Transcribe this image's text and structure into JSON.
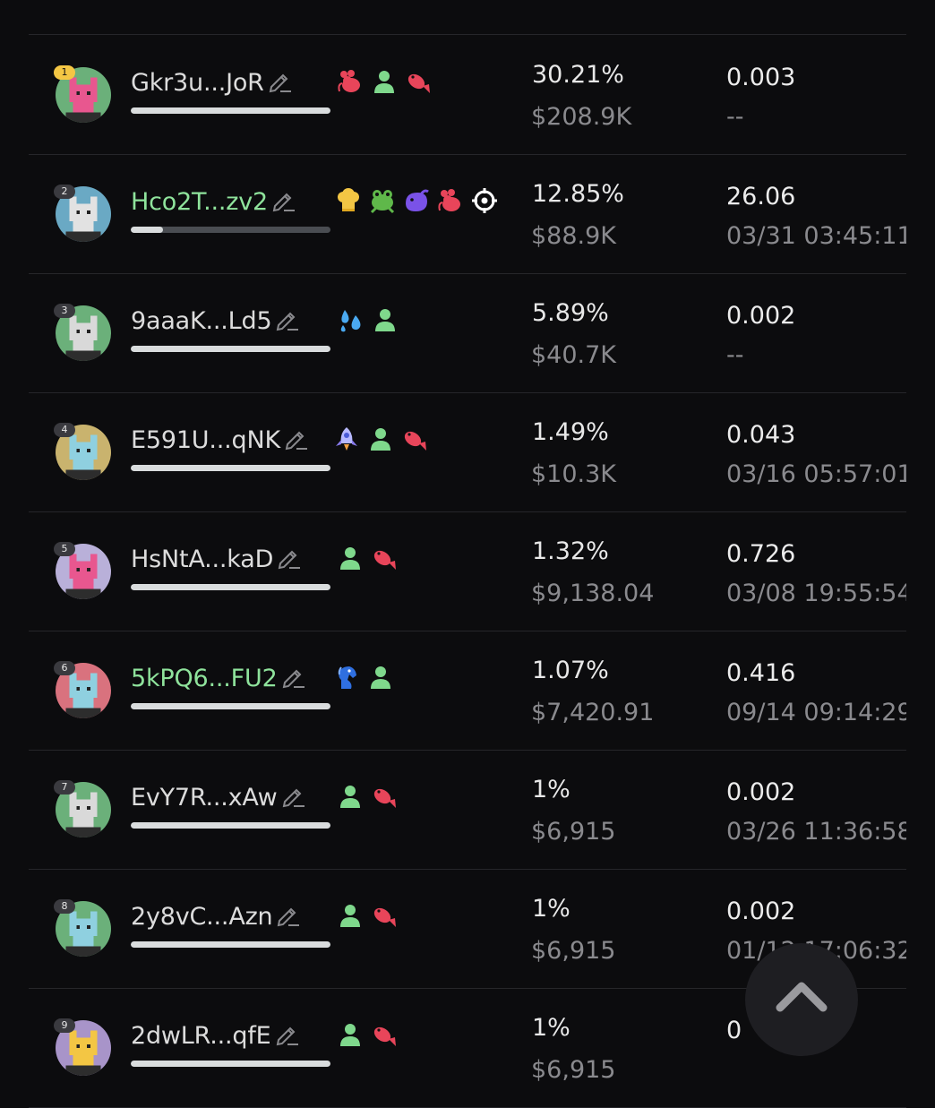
{
  "rows": [
    {
      "rank": "1",
      "name": "Gkr3u...JoR",
      "highlight": false,
      "pct": "30.21%",
      "usd": "$208.9K",
      "amount": "0.003",
      "time": "--",
      "bar": 1.0,
      "avatar_bg": "#6bb07a",
      "avatar_fg": "#e8578f",
      "tags": [
        "rat-icon",
        "person-icon",
        "fish-icon"
      ]
    },
    {
      "rank": "2",
      "name": "Hco2T...zv2",
      "highlight": true,
      "pct": "12.85%",
      "usd": "$88.9K",
      "amount": "26.06",
      "time": "03/31 03:45:11",
      "bar": 0.16,
      "avatar_bg": "#6aa9c4",
      "avatar_fg": "#e2e2e2",
      "tags": [
        "chef-hat-icon",
        "frog-icon",
        "whale-icon",
        "rat-icon",
        "target-icon"
      ]
    },
    {
      "rank": "3",
      "name": "9aaaK...Ld5",
      "highlight": false,
      "pct": "5.89%",
      "usd": "$40.7K",
      "amount": "0.002",
      "time": "--",
      "bar": 1.0,
      "avatar_bg": "#6bb07a",
      "avatar_fg": "#d9d9d9",
      "tags": [
        "sweat-drops-icon",
        "person-icon"
      ]
    },
    {
      "rank": "4",
      "name": "E591U...qNK",
      "highlight": false,
      "pct": "1.49%",
      "usd": "$10.3K",
      "amount": "0.043",
      "time": "03/16 05:57:01",
      "bar": 1.0,
      "avatar_bg": "#c9b36e",
      "avatar_fg": "#8fd0e0",
      "tags": [
        "rocket-icon",
        "person-icon",
        "fish-icon"
      ]
    },
    {
      "rank": "5",
      "name": "HsNtA...kaD",
      "highlight": false,
      "pct": "1.32%",
      "usd": "$9,138.04",
      "amount": "0.726",
      "time": "03/08 19:55:54",
      "bar": 1.0,
      "avatar_bg": "#b9b0d9",
      "avatar_fg": "#e8578f",
      "tags": [
        "person-icon",
        "fish-icon"
      ]
    },
    {
      "rank": "6",
      "name": "5kPQ6...FU2",
      "highlight": true,
      "pct": "1.07%",
      "usd": "$7,420.91",
      "amount": "0.416",
      "time": "09/14 09:14:29",
      "bar": 1.0,
      "avatar_bg": "#d9727e",
      "avatar_fg": "#8fd0e0",
      "tags": [
        "horse-icon",
        "person-icon"
      ]
    },
    {
      "rank": "7",
      "name": "EvY7R...xAw",
      "highlight": false,
      "pct": "1%",
      "usd": "$6,915",
      "amount": "0.002",
      "time": "03/26 11:36:58",
      "bar": 1.0,
      "avatar_bg": "#6bb07a",
      "avatar_fg": "#d9d9d9",
      "tags": [
        "person-icon",
        "fish-icon"
      ]
    },
    {
      "rank": "8",
      "name": "2y8vC...Azn",
      "highlight": false,
      "pct": "1%",
      "usd": "$6,915",
      "amount": "0.002",
      "time": "01/12 17:06:32",
      "bar": 1.0,
      "avatar_bg": "#6bb07a",
      "avatar_fg": "#8fd0e0",
      "tags": [
        "person-icon",
        "fish-icon"
      ]
    },
    {
      "rank": "9",
      "name": "2dwLR...qfE",
      "highlight": false,
      "pct": "1%",
      "usd": "$6,915",
      "amount": "0",
      "time": "",
      "bar": 1.0,
      "avatar_bg": "#a894c9",
      "avatar_fg": "#f3c644",
      "tags": [
        "person-icon",
        "fish-icon"
      ]
    }
  ],
  "colors": {
    "accent_green": "#8fe39c",
    "rank1_gold": "#f3c644",
    "fish_red": "#e8455a"
  },
  "scroll_top_icon": "chevron-up-icon"
}
